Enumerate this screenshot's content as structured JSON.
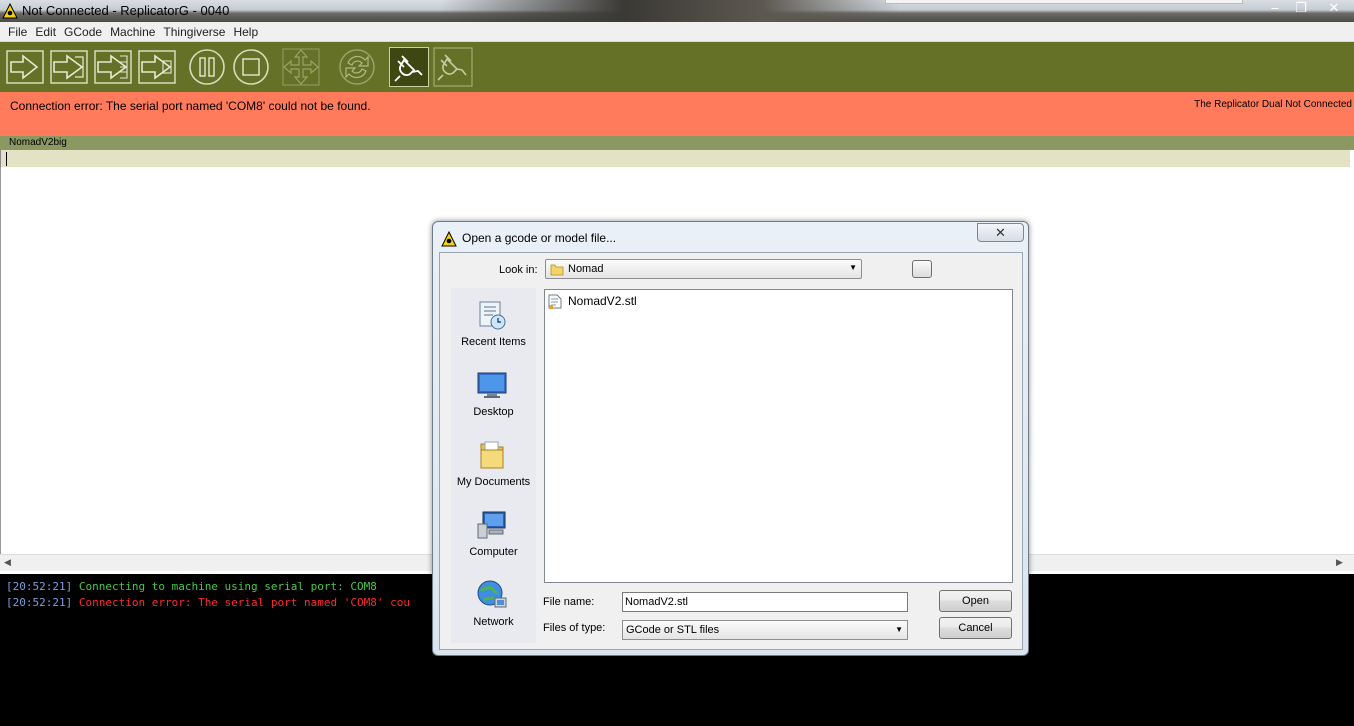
{
  "window": {
    "title": "Not Connected - ReplicatorG - 0040",
    "controls": {
      "minimize": "–",
      "maximize": "❐",
      "close": "✕"
    }
  },
  "menu": [
    "File",
    "Edit",
    "GCode",
    "Machine",
    "Thingiverse",
    "Help"
  ],
  "toolbar": {
    "buttons": [
      {
        "name": "build-button",
        "icon": "build-icon"
      },
      {
        "name": "upload-button",
        "icon": "upload-icon"
      },
      {
        "name": "build-to-file-button",
        "icon": "build-to-file-icon"
      },
      {
        "name": "build-from-sd-button",
        "icon": "build-sd-icon"
      },
      {
        "name": "pause-button",
        "icon": "pause-icon"
      },
      {
        "name": "stop-button",
        "icon": "stop-icon"
      },
      {
        "name": "control-panel-button",
        "icon": "move-icon"
      },
      {
        "name": "reset-button",
        "icon": "reset-icon"
      },
      {
        "name": "connect-button",
        "icon": "plug-icon",
        "active": true
      },
      {
        "name": "disconnect-button",
        "icon": "unplug-icon"
      }
    ],
    "color": "#647126"
  },
  "status": {
    "message": "Connection error: The serial port named 'COM8' could not be found.",
    "machine": "The Replicator Dual Not Connected",
    "color": "#ff7b5c"
  },
  "editor": {
    "tab_label": "NomadV2big"
  },
  "scrollbar": {
    "left": "◀",
    "right": "▶"
  },
  "console": {
    "lines": [
      {
        "time": "[20:52:21]",
        "text": "Connecting to machine using serial port: COM8",
        "kind": "ok"
      },
      {
        "time": "[20:52:21]",
        "text": "Connection error: The serial port named 'COM8' cou",
        "kind": "err"
      }
    ]
  },
  "dialog": {
    "title": "Open a gcode or model file...",
    "close_glyph": "✕",
    "look_in_label": "Look in:",
    "look_in_value": "Nomad",
    "chevron": "▼",
    "places": [
      {
        "label": "Recent Items",
        "icon": "recent-items-icon"
      },
      {
        "label": "Desktop",
        "icon": "desktop-icon"
      },
      {
        "label": "My Documents",
        "icon": "my-documents-icon"
      },
      {
        "label": "Computer",
        "icon": "computer-icon"
      },
      {
        "label": "Network",
        "icon": "network-icon"
      }
    ],
    "files": [
      {
        "name": "NomadV2.stl",
        "icon": "stl-file-icon"
      }
    ],
    "file_name_label": "File name:",
    "file_name_value": "NomadV2.stl",
    "file_type_label": "Files of type:",
    "file_type_value": "GCode or STL files",
    "open_label": "Open",
    "cancel_label": "Cancel"
  }
}
